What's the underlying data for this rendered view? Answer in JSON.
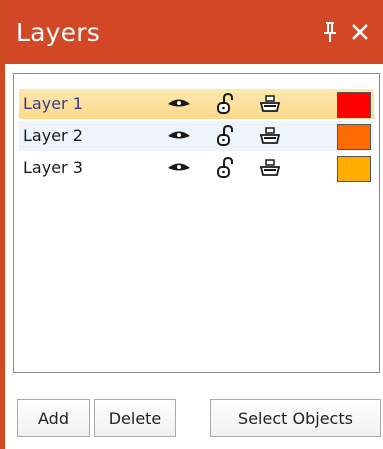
{
  "panel": {
    "title": "Layers",
    "header_color": "#d24726",
    "header_icons": [
      "pin-icon",
      "close-icon"
    ]
  },
  "layers": [
    {
      "name": "Layer 1",
      "color": "#ff0000",
      "selected": true,
      "icons": [
        "eye-icon",
        "lock-icon",
        "print-icon"
      ]
    },
    {
      "name": "Layer 2",
      "color": "#ff6a00",
      "selected": false,
      "icons": [
        "eye-icon",
        "lock-icon",
        "print-icon"
      ]
    },
    {
      "name": "Layer 3",
      "color": "#ffae00",
      "selected": false,
      "icons": [
        "eye-icon",
        "lock-icon",
        "print-icon"
      ]
    }
  ],
  "buttons": {
    "add": "Add",
    "delete": "Delete",
    "select_objects": "Select Objects"
  }
}
